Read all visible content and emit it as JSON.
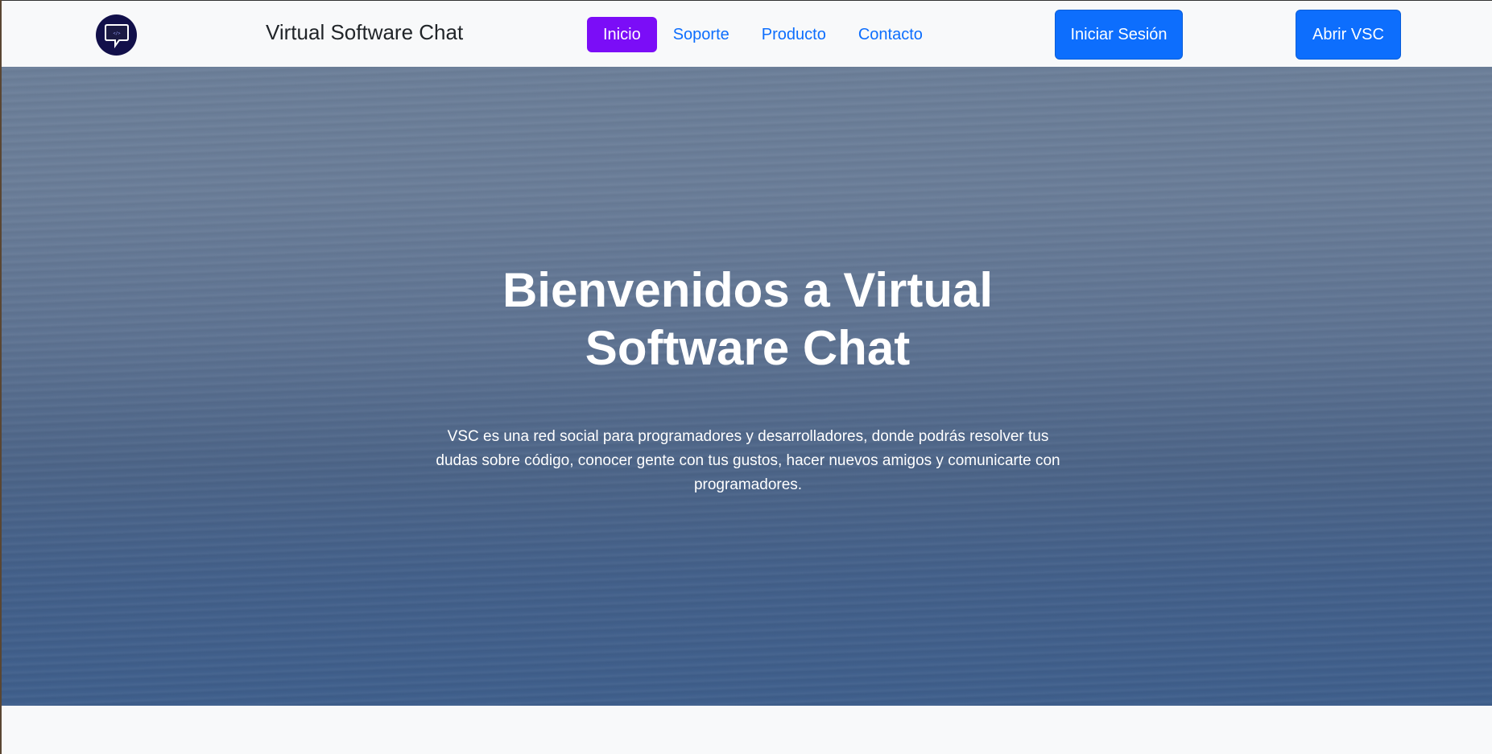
{
  "header": {
    "brand": "Virtual Software Chat",
    "nav": [
      {
        "label": "Inicio",
        "active": true
      },
      {
        "label": "Soporte",
        "active": false
      },
      {
        "label": "Producto",
        "active": false
      },
      {
        "label": "Contacto",
        "active": false
      }
    ],
    "login_label": "Iniciar Sesión",
    "open_label": "Abrir VSC",
    "logo_icon": "chat-bubble-icon"
  },
  "hero": {
    "title_line1": "Bienvenidos a Virtual",
    "title_line2": "Software Chat",
    "description": "VSC es una red social para programadores y desarrolladores, donde podrás resolver tus dudas sobre código, conocer gente con tus gustos, hacer nuevos amigos y comunicarte con programadores."
  },
  "colors": {
    "accent_active": "#7b0df7",
    "primary": "#0d6efd",
    "logo_bg": "#12104a"
  }
}
